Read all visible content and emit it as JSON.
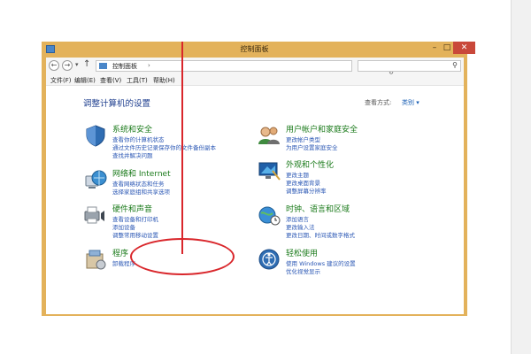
{
  "window": {
    "title": "控制面板"
  },
  "address": {
    "path": "控制面板",
    "arrow": "›",
    "right_controls": "▾ ↻"
  },
  "menu": {
    "file": "文件(F)",
    "edit": "编辑(E)",
    "view": "查看(V)",
    "tools": "工具(T)",
    "help": "帮助(H)"
  },
  "content": {
    "heading": "调整计算机的设置",
    "view_by_label": "查看方式:",
    "view_by_value": "类别 ▾"
  },
  "categories": [
    {
      "title": "系统和安全",
      "links": [
        "查看你的计算机状态",
        "通过文件历史记录保存你的文件备份副本",
        "查找并解决问题"
      ]
    },
    {
      "title": "网络和 Internet",
      "links": [
        "查看网络状态和任务",
        "选择家庭组和共享选项"
      ]
    },
    {
      "title": "硬件和声音",
      "links": [
        "查看设备和打印机",
        "添加设备",
        "调整常用移动设置"
      ]
    },
    {
      "title": "程序",
      "links": [
        "卸载程序"
      ]
    },
    {
      "title": "用户帐户和家庭安全",
      "links": [
        "更改帐户类型",
        "为用户设置家庭安全"
      ]
    },
    {
      "title": "外观和个性化",
      "links": [
        "更改主题",
        "更改桌面背景",
        "调整屏幕分辨率"
      ]
    },
    {
      "title": "时钟、语言和区域",
      "links": [
        "添加语言",
        "更改输入法",
        "更改日期、时间或数字格式"
      ]
    },
    {
      "title": "轻松使用",
      "links": [
        "使用 Windows 建议的设置",
        "优化视觉显示"
      ]
    }
  ],
  "colors": {
    "window_frame": "#e3b25b",
    "category_title": "#1a7a1a",
    "link": "#2c58b5",
    "heading": "#1f3f8f",
    "annotation": "#d9262b"
  }
}
